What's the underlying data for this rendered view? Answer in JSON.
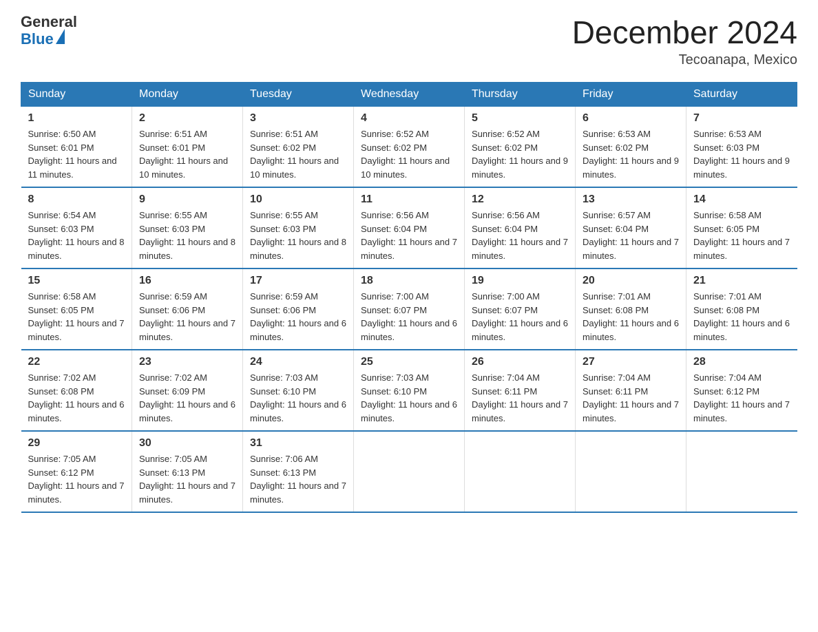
{
  "header": {
    "logo_general": "General",
    "logo_blue": "Blue",
    "title": "December 2024",
    "location": "Tecoanapa, Mexico"
  },
  "days_of_week": [
    "Sunday",
    "Monday",
    "Tuesday",
    "Wednesday",
    "Thursday",
    "Friday",
    "Saturday"
  ],
  "weeks": [
    [
      {
        "day": "1",
        "sunrise": "6:50 AM",
        "sunset": "6:01 PM",
        "daylight": "11 hours and 11 minutes."
      },
      {
        "day": "2",
        "sunrise": "6:51 AM",
        "sunset": "6:01 PM",
        "daylight": "11 hours and 10 minutes."
      },
      {
        "day": "3",
        "sunrise": "6:51 AM",
        "sunset": "6:02 PM",
        "daylight": "11 hours and 10 minutes."
      },
      {
        "day": "4",
        "sunrise": "6:52 AM",
        "sunset": "6:02 PM",
        "daylight": "11 hours and 10 minutes."
      },
      {
        "day": "5",
        "sunrise": "6:52 AM",
        "sunset": "6:02 PM",
        "daylight": "11 hours and 9 minutes."
      },
      {
        "day": "6",
        "sunrise": "6:53 AM",
        "sunset": "6:02 PM",
        "daylight": "11 hours and 9 minutes."
      },
      {
        "day": "7",
        "sunrise": "6:53 AM",
        "sunset": "6:03 PM",
        "daylight": "11 hours and 9 minutes."
      }
    ],
    [
      {
        "day": "8",
        "sunrise": "6:54 AM",
        "sunset": "6:03 PM",
        "daylight": "11 hours and 8 minutes."
      },
      {
        "day": "9",
        "sunrise": "6:55 AM",
        "sunset": "6:03 PM",
        "daylight": "11 hours and 8 minutes."
      },
      {
        "day": "10",
        "sunrise": "6:55 AM",
        "sunset": "6:03 PM",
        "daylight": "11 hours and 8 minutes."
      },
      {
        "day": "11",
        "sunrise": "6:56 AM",
        "sunset": "6:04 PM",
        "daylight": "11 hours and 7 minutes."
      },
      {
        "day": "12",
        "sunrise": "6:56 AM",
        "sunset": "6:04 PM",
        "daylight": "11 hours and 7 minutes."
      },
      {
        "day": "13",
        "sunrise": "6:57 AM",
        "sunset": "6:04 PM",
        "daylight": "11 hours and 7 minutes."
      },
      {
        "day": "14",
        "sunrise": "6:58 AM",
        "sunset": "6:05 PM",
        "daylight": "11 hours and 7 minutes."
      }
    ],
    [
      {
        "day": "15",
        "sunrise": "6:58 AM",
        "sunset": "6:05 PM",
        "daylight": "11 hours and 7 minutes."
      },
      {
        "day": "16",
        "sunrise": "6:59 AM",
        "sunset": "6:06 PM",
        "daylight": "11 hours and 7 minutes."
      },
      {
        "day": "17",
        "sunrise": "6:59 AM",
        "sunset": "6:06 PM",
        "daylight": "11 hours and 6 minutes."
      },
      {
        "day": "18",
        "sunrise": "7:00 AM",
        "sunset": "6:07 PM",
        "daylight": "11 hours and 6 minutes."
      },
      {
        "day": "19",
        "sunrise": "7:00 AM",
        "sunset": "6:07 PM",
        "daylight": "11 hours and 6 minutes."
      },
      {
        "day": "20",
        "sunrise": "7:01 AM",
        "sunset": "6:08 PM",
        "daylight": "11 hours and 6 minutes."
      },
      {
        "day": "21",
        "sunrise": "7:01 AM",
        "sunset": "6:08 PM",
        "daylight": "11 hours and 6 minutes."
      }
    ],
    [
      {
        "day": "22",
        "sunrise": "7:02 AM",
        "sunset": "6:08 PM",
        "daylight": "11 hours and 6 minutes."
      },
      {
        "day": "23",
        "sunrise": "7:02 AM",
        "sunset": "6:09 PM",
        "daylight": "11 hours and 6 minutes."
      },
      {
        "day": "24",
        "sunrise": "7:03 AM",
        "sunset": "6:10 PM",
        "daylight": "11 hours and 6 minutes."
      },
      {
        "day": "25",
        "sunrise": "7:03 AM",
        "sunset": "6:10 PM",
        "daylight": "11 hours and 6 minutes."
      },
      {
        "day": "26",
        "sunrise": "7:04 AM",
        "sunset": "6:11 PM",
        "daylight": "11 hours and 7 minutes."
      },
      {
        "day": "27",
        "sunrise": "7:04 AM",
        "sunset": "6:11 PM",
        "daylight": "11 hours and 7 minutes."
      },
      {
        "day": "28",
        "sunrise": "7:04 AM",
        "sunset": "6:12 PM",
        "daylight": "11 hours and 7 minutes."
      }
    ],
    [
      {
        "day": "29",
        "sunrise": "7:05 AM",
        "sunset": "6:12 PM",
        "daylight": "11 hours and 7 minutes."
      },
      {
        "day": "30",
        "sunrise": "7:05 AM",
        "sunset": "6:13 PM",
        "daylight": "11 hours and 7 minutes."
      },
      {
        "day": "31",
        "sunrise": "7:06 AM",
        "sunset": "6:13 PM",
        "daylight": "11 hours and 7 minutes."
      },
      null,
      null,
      null,
      null
    ]
  ]
}
